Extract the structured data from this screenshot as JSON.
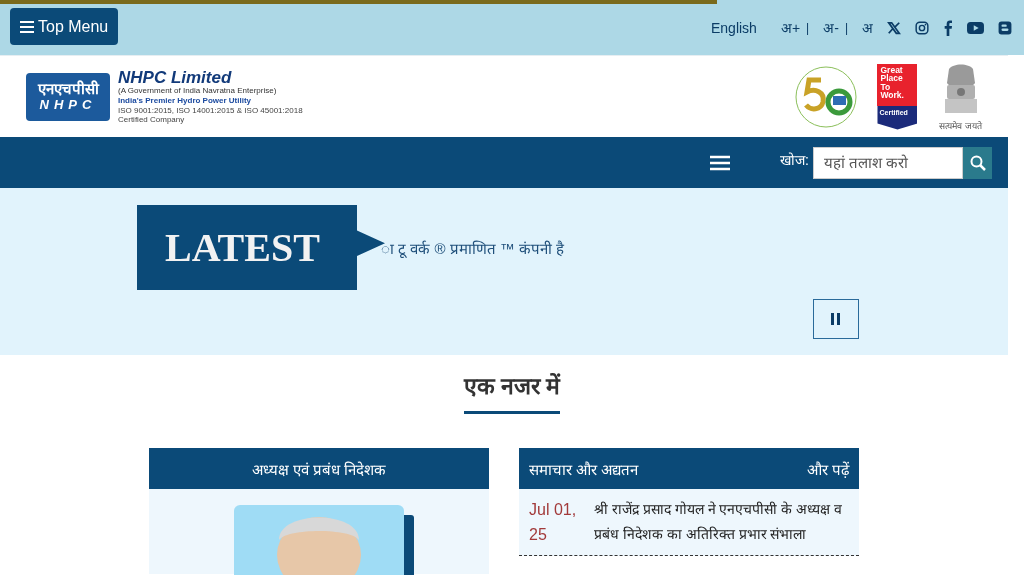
{
  "page_progress": {
    "level": 0.7
  },
  "top_bar": {
    "menu_button": "Top Menu",
    "language": "English",
    "font_controls": [
      {
        "label": "अ+",
        "separator": "|"
      },
      {
        "label": "अ-",
        "separator": "|"
      },
      {
        "label": "अ"
      }
    ],
    "social": [
      {
        "kind": "x"
      },
      {
        "kind": "instagram"
      },
      {
        "kind": "facebook"
      },
      {
        "kind": "youtube"
      },
      {
        "kind": "blogger"
      }
    ]
  },
  "header": {
    "logo": {
      "hindi": "एनएचपीसी",
      "latin": "NHPC"
    },
    "company": "NHPC Limited",
    "subtitle": "(A Government of India Navratna Enterprise)",
    "tagline": "India's Premier Hydro Power Utility",
    "certification": "ISO 9001:2015, ISO 14001:2015 & ISO 45001:2018 Certified Company",
    "badge": {
      "lines": [
        "Great",
        "Place",
        "To",
        "Work."
      ],
      "certified": "Certified"
    },
    "emblem_motto": "सत्यमेव जयते"
  },
  "nav": {
    "search_label": "खोज:",
    "search_placeholder": "यहां तलाश करो"
  },
  "latest": {
    "title": "LATEST",
    "ticker": "ा टू वर्क ® प्रमाणित ™ कंपनी है",
    "paused": false
  },
  "section": {
    "heading": "एक नजर में",
    "cmd_card": {
      "title": "अध्यक्ष एवं प्रबंध निदेशक"
    },
    "news_card": {
      "title": "समाचार और अद्यतन",
      "more": "और पढ़ें",
      "items": [
        {
          "date": "Jul 01, 25",
          "text": "श्री राजेंद्र प्रसाद गोयल ने एनएचपीसी के अध्यक्ष व प्रबंध निदेशक का अतिरिक्त प्रभार संभाला"
        }
      ]
    }
  }
}
